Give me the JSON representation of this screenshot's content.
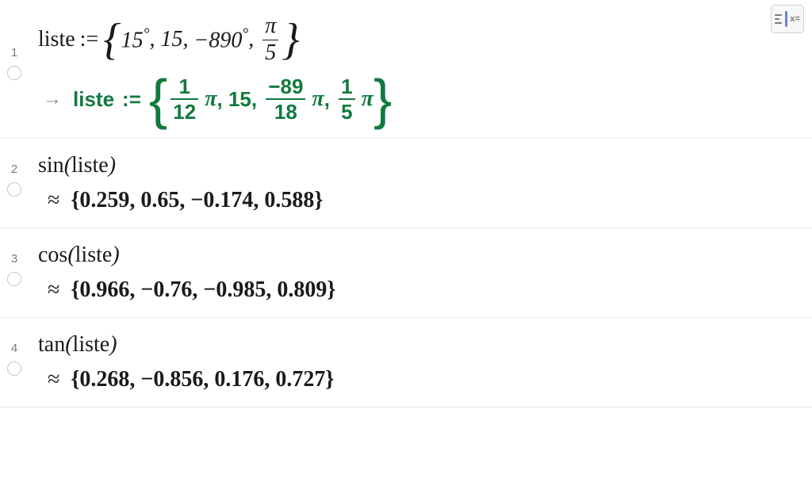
{
  "toolbar": {
    "symbolic_label": "x="
  },
  "row1": {
    "num": "1",
    "var": "liste",
    "assign": ":=",
    "in_items": {
      "a": "15",
      "adeg": "°",
      "b": "15",
      "c": "−890",
      "cdeg": "°",
      "d_num": "π",
      "d_den": "5"
    },
    "out_label": "liste",
    "out_assign": ":=",
    "out_items": {
      "a_num": "1",
      "a_den": "12",
      "b": "15",
      "c_num": "−89",
      "c_den": "18",
      "d_num": "1",
      "d_den": "5",
      "pi": "π"
    }
  },
  "row2": {
    "num": "2",
    "fn": "sin",
    "arg": "liste",
    "out": "{0.259, 0.65, −0.174, 0.588}"
  },
  "row3": {
    "num": "3",
    "fn": "cos",
    "arg": "liste",
    "out": "{0.966, −0.76, −0.985, 0.809}"
  },
  "row4": {
    "num": "4",
    "fn": "tan",
    "arg": "liste",
    "out": "{0.268, −0.856, 0.176, 0.727}"
  },
  "symbols": {
    "arrow": "→",
    "approx": "≈"
  }
}
